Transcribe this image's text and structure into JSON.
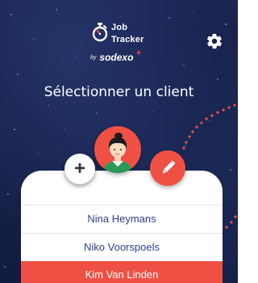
{
  "app": {
    "logo_line1": "Job",
    "logo_line2": "Tracker",
    "by": "by",
    "brand": "sodexo"
  },
  "header": {
    "title": "Sélectionner un client"
  },
  "actions": {
    "add_label": "+"
  },
  "clients": [
    {
      "name": "Nina Heymans",
      "selected": false
    },
    {
      "name": "Niko Voorspoels",
      "selected": false
    },
    {
      "name": "Kim Van Linden",
      "selected": true
    }
  ],
  "colors": {
    "background": "#16214a",
    "accent": "#ef5044",
    "client_text": "#2d3f8f",
    "white": "#ffffff"
  },
  "icons": {
    "logo": "stopwatch-icon",
    "settings": "gear-icon",
    "add": "plus-icon",
    "edit": "pencil-icon",
    "avatar": "user-avatar"
  }
}
